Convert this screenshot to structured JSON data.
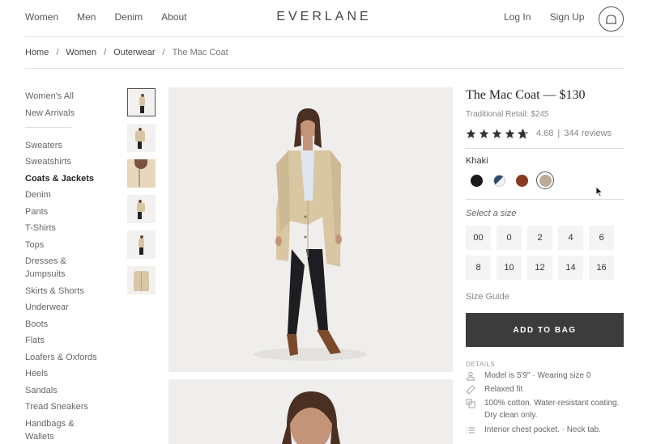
{
  "header": {
    "nav_left": [
      "Women",
      "Men",
      "Denim",
      "About"
    ],
    "logo": "EVERLANE",
    "nav_right": [
      "Log In",
      "Sign Up"
    ],
    "cart_icon": "cart-icon"
  },
  "breadcrumb": [
    "Home",
    "Women",
    "Outerwear",
    "The Mac Coat"
  ],
  "sidenav": {
    "top": [
      "Women's All",
      "New Arrivals"
    ],
    "categories": [
      "Sweaters",
      "Sweatshirts",
      "Coats & Jackets",
      "Denim",
      "Pants",
      "T-Shirts",
      "Tops",
      "Dresses &",
      "Jumpsuits",
      "Skirts & Shorts",
      "Underwear",
      "Boots",
      "Flats",
      "Loafers & Oxfords",
      "Heels",
      "Sandals",
      "Tread Sneakers",
      "Handbags &",
      "Wallets"
    ],
    "active": "Coats & Jackets"
  },
  "product": {
    "title": "The Mac Coat — $130",
    "retail": "Traditional Retail: $245",
    "rating_value": "4.68",
    "rating_sep": "|",
    "review_count": "344 reviews",
    "stars": 4.68,
    "color_label": "Khaki",
    "swatches": [
      {
        "name": "black",
        "color": "#1a1a1a"
      },
      {
        "name": "navy-white",
        "color": "#2c4a6e"
      },
      {
        "name": "rust",
        "color": "#8a3a22"
      },
      {
        "name": "khaki",
        "color": "#b8ab98",
        "selected": true
      }
    ],
    "size_label": "Select a size",
    "sizes": [
      "00",
      "0",
      "2",
      "4",
      "6",
      "8",
      "10",
      "12",
      "14",
      "16"
    ],
    "size_guide": "Size Guide",
    "add_to_bag": "ADD TO BAG",
    "details_label": "DETAILS",
    "details": [
      {
        "icon": "person-icon",
        "text": "Model is 5'9\"  ·  Wearing size 0"
      },
      {
        "icon": "ruler-icon",
        "text": "Relaxed fit"
      },
      {
        "icon": "fabric-icon",
        "text": "100% cotton. Water-resistant coating."
      },
      {
        "icon": "",
        "text": "Dry clean only."
      },
      {
        "icon": "list-icon",
        "text": "Interior chest pocket.  ·  Neck tab."
      }
    ]
  },
  "colors": {
    "button_dark": "#3c3c3c",
    "image_bg": "#efeeec",
    "coat_khaki": "#d7c4a3"
  }
}
